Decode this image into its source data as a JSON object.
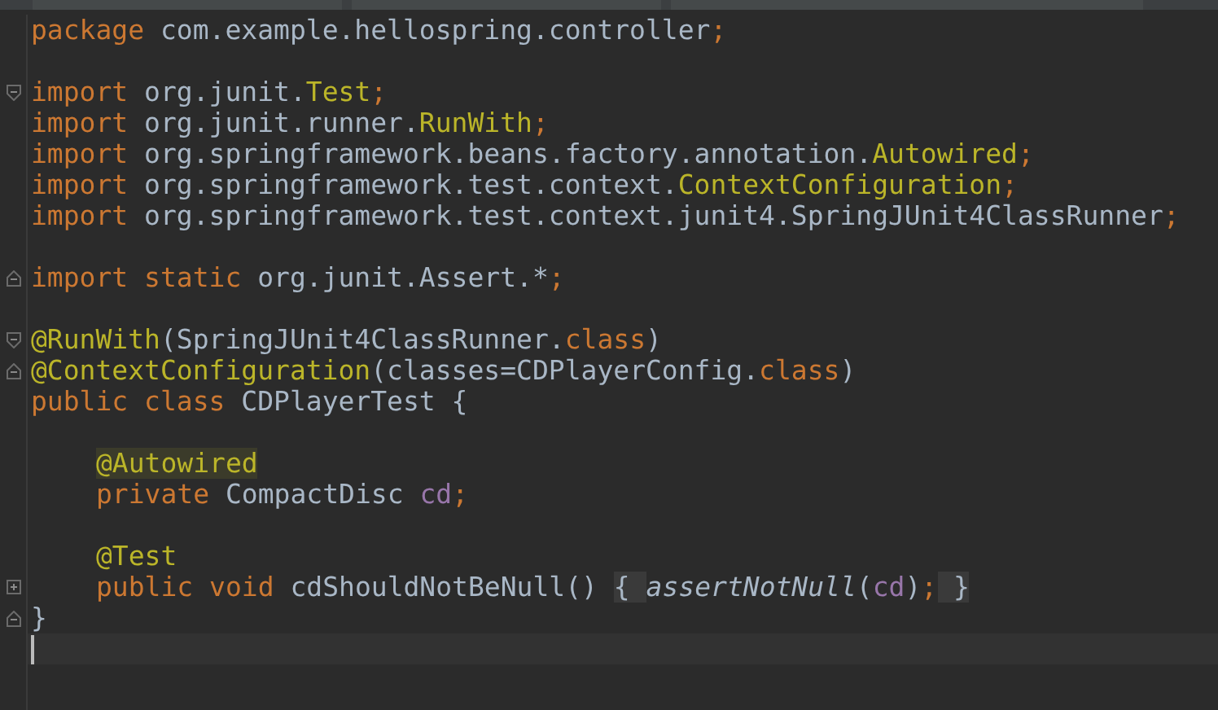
{
  "editor": {
    "lines": [
      {
        "kind": "code",
        "tokens": [
          {
            "text": "package",
            "kind": "keyword"
          },
          {
            "text": " com.example.hellospring.controller",
            "kind": "plain"
          },
          {
            "text": ";",
            "kind": "keyword"
          }
        ]
      },
      {
        "kind": "blank"
      },
      {
        "kind": "fold-start",
        "tokens": [
          {
            "text": "import",
            "kind": "keyword"
          },
          {
            "text": " org.junit.",
            "kind": "plain"
          },
          {
            "text": "Test",
            "kind": "annotation"
          },
          {
            "text": ";",
            "kind": "keyword"
          }
        ]
      },
      {
        "kind": "code",
        "tokens": [
          {
            "text": "import",
            "kind": "keyword"
          },
          {
            "text": " org.junit.runner.",
            "kind": "plain"
          },
          {
            "text": "RunWith",
            "kind": "annotation"
          },
          {
            "text": ";",
            "kind": "keyword"
          }
        ]
      },
      {
        "kind": "code",
        "tokens": [
          {
            "text": "import",
            "kind": "keyword"
          },
          {
            "text": " org.springframework.beans.factory.annotation.",
            "kind": "plain"
          },
          {
            "text": "Autowired",
            "kind": "annotation"
          },
          {
            "text": ";",
            "kind": "keyword"
          }
        ]
      },
      {
        "kind": "code",
        "tokens": [
          {
            "text": "import",
            "kind": "keyword"
          },
          {
            "text": " org.springframework.test.context.",
            "kind": "plain"
          },
          {
            "text": "ContextConfiguration",
            "kind": "annotation"
          },
          {
            "text": ";",
            "kind": "keyword"
          }
        ]
      },
      {
        "kind": "code",
        "tokens": [
          {
            "text": "import",
            "kind": "keyword"
          },
          {
            "text": " org.springframework.test.context.junit4.SpringJUnit4ClassRunner",
            "kind": "plain"
          },
          {
            "text": ";",
            "kind": "keyword"
          }
        ]
      },
      {
        "kind": "blank"
      },
      {
        "kind": "fold-end",
        "tokens": [
          {
            "text": "import static",
            "kind": "keyword"
          },
          {
            "text": " org.junit.Assert.*",
            "kind": "plain"
          },
          {
            "text": ";",
            "kind": "keyword"
          }
        ]
      },
      {
        "kind": "blank"
      },
      {
        "kind": "fold-start",
        "tokens": [
          {
            "text": "@RunWith",
            "kind": "annotation"
          },
          {
            "text": "(SpringJUnit4ClassRunner.",
            "kind": "plain"
          },
          {
            "text": "class",
            "kind": "keyword"
          },
          {
            "text": ")",
            "kind": "plain"
          }
        ]
      },
      {
        "kind": "fold-end",
        "tokens": [
          {
            "text": "@ContextConfiguration",
            "kind": "annotation"
          },
          {
            "text": "(classes=CDPlayerConfig.",
            "kind": "plain"
          },
          {
            "text": "class",
            "kind": "keyword"
          },
          {
            "text": ")",
            "kind": "plain"
          }
        ]
      },
      {
        "kind": "code",
        "tokens": [
          {
            "text": "public class",
            "kind": "keyword"
          },
          {
            "text": " CDPlayerTest {",
            "kind": "plain"
          }
        ],
        "children": [
          {
            "kind": "blank"
          },
          {
            "kind": "code",
            "tokens": [
              {
                "text": "@Autowired",
                "kind": "annotation-highlighted"
              }
            ]
          },
          {
            "kind": "code",
            "tokens": [
              {
                "text": "private",
                "kind": "keyword"
              },
              {
                "text": " CompactDisc ",
                "kind": "plain"
              },
              {
                "text": "cd",
                "kind": "field"
              },
              {
                "text": ";",
                "kind": "keyword"
              }
            ]
          },
          {
            "kind": "blank"
          },
          {
            "kind": "code",
            "tokens": [
              {
                "text": "@Test",
                "kind": "annotation"
              }
            ]
          },
          {
            "kind": "fold-collapsed",
            "tokens": [
              {
                "text": "public void",
                "kind": "keyword"
              },
              {
                "text": " cdShouldNotBeNull() ",
                "kind": "plain"
              },
              {
                "text": "{ ",
                "kind": "folded"
              },
              {
                "text": "assertNotNull",
                "kind": "static-call"
              },
              {
                "text": "(",
                "kind": "plain"
              },
              {
                "text": "cd",
                "kind": "field"
              },
              {
                "text": ")",
                "kind": "plain"
              },
              {
                "text": ";",
                "kind": "keyword"
              },
              {
                "text": " }",
                "kind": "folded"
              }
            ]
          }
        ]
      },
      {
        "kind": "fold-end",
        "tokens": [
          {
            "text": "}",
            "kind": "plain"
          }
        ]
      },
      {
        "kind": "cursor"
      }
    ]
  }
}
